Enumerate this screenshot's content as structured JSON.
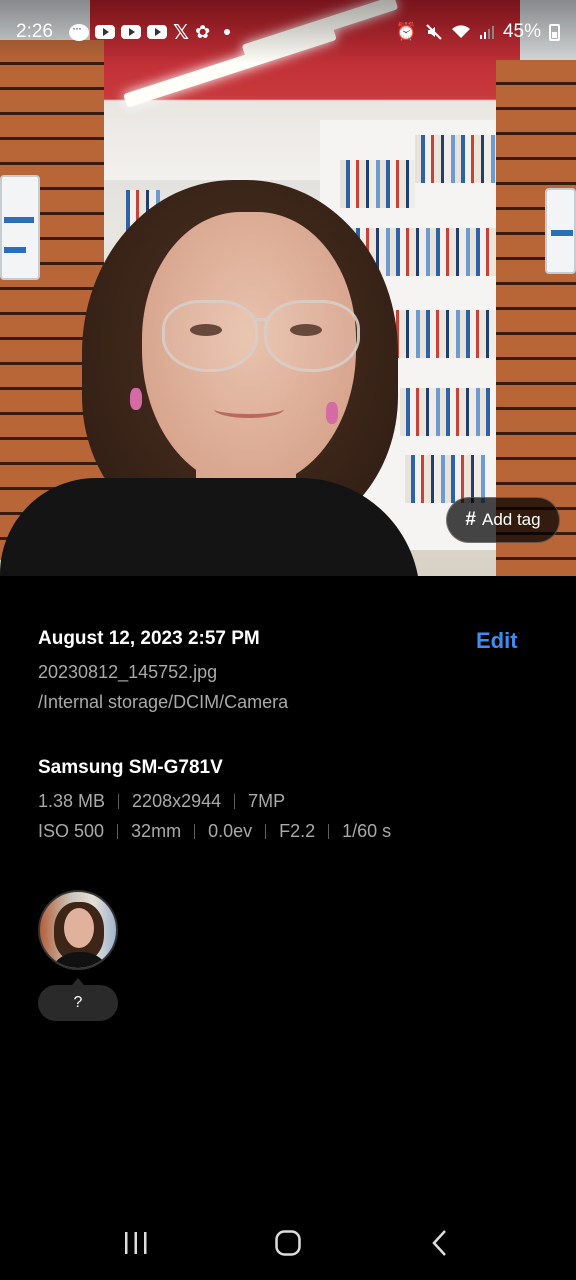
{
  "status_bar": {
    "time": "2:26",
    "battery_pct": "45%",
    "notification_icons": [
      "chat-icon",
      "youtube-icon",
      "youtube-icon",
      "youtube-icon",
      "x-icon",
      "settings-bug-icon",
      "dot-icon"
    ],
    "system_icons": [
      "alarm-icon",
      "mute-icon",
      "wifi-icon",
      "signal-icon",
      "battery-icon"
    ]
  },
  "photo": {
    "add_tag_label": "Add tag",
    "add_tag_icon": "hash-icon"
  },
  "details": {
    "date_time": "August 12, 2023 2:57 PM",
    "edit_label": "Edit",
    "filename": "20230812_145752.jpg",
    "path": "/Internal storage/DCIM/Camera",
    "device": "Samsung SM-G781V",
    "file_info": [
      "1.38 MB",
      "2208x2944",
      "7MP"
    ],
    "camera_info": [
      "ISO 500",
      "32mm",
      "0.0ev",
      "F2.2",
      "1/60 s"
    ]
  },
  "people": {
    "unknown_label": "?"
  },
  "nav": {
    "icons": [
      "recents-icon",
      "home-icon",
      "back-icon"
    ]
  },
  "colors": {
    "accent": "#3e8ef0",
    "background": "#000000",
    "secondary_text": "#a9a9a9"
  }
}
